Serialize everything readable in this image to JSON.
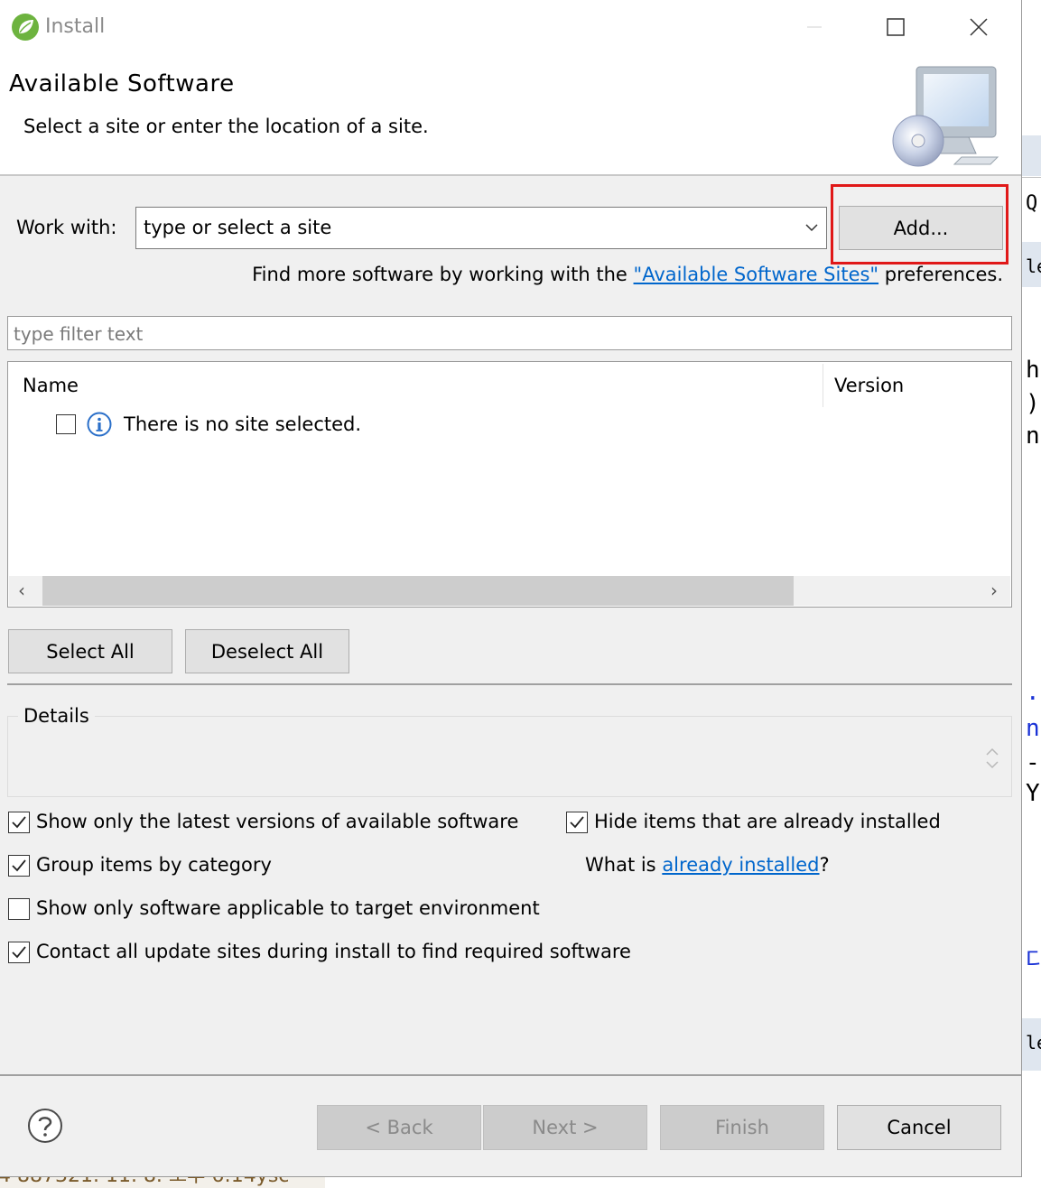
{
  "window": {
    "title": "Install"
  },
  "header": {
    "title": "Available Software",
    "description": "Select a site or enter the location of a site."
  },
  "work_with": {
    "label": "Work with:",
    "placeholder": "type or select a site",
    "add_button": "Add..."
  },
  "find_more": {
    "prefix": "Find more software by working with the ",
    "link": "\"Available Software Sites\"",
    "suffix": " preferences."
  },
  "filter": {
    "placeholder": "type filter text"
  },
  "tree": {
    "columns": [
      "Name",
      "Version"
    ],
    "rows": [
      {
        "label": "There is no site selected.",
        "checked": false
      }
    ]
  },
  "buttons": {
    "select_all": "Select All",
    "deselect_all": "Deselect All"
  },
  "details": {
    "label": "Details"
  },
  "options": {
    "latest_versions": {
      "label": "Show only the latest versions of available software",
      "checked": true
    },
    "hide_installed": {
      "label": "Hide items that are already installed",
      "checked": true
    },
    "group_by_category": {
      "label": "Group items by category",
      "checked": true
    },
    "target_env": {
      "label": "Show only software applicable to target environment",
      "checked": false
    },
    "contact_sites": {
      "label": "Contact all update sites during install to find required software",
      "checked": true
    }
  },
  "installed_question": {
    "prefix": "What is ",
    "link": "already installed",
    "suffix": "?"
  },
  "footer": {
    "back": "< Back",
    "next": "Next >",
    "finish": "Finish",
    "cancel": "Cancel"
  },
  "background_app": {
    "fragments": [
      "Q",
      "ler",
      "h",
      ")",
      "nt",
      ".",
      "n",
      "-",
      "Y",
      "다",
      "le"
    ],
    "status_text": "4 887321. 11. 8. 오후 6:14ysc"
  },
  "colors": {
    "highlight": "#e01818",
    "link": "#0066cc",
    "dialog_bg": "#f0f0f0"
  }
}
